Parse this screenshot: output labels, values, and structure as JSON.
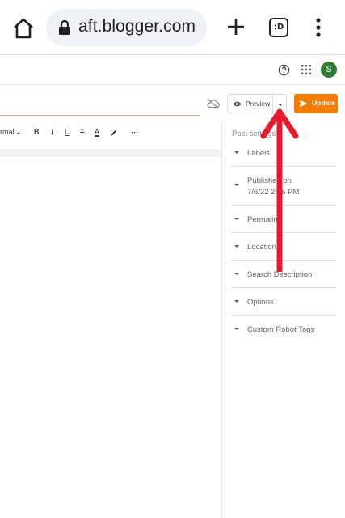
{
  "browser": {
    "url_display": "aft.blogger.com",
    "tab_switcher_label": ":D",
    "icons": [
      "home-icon",
      "lock-icon",
      "new-tab-icon",
      "tab-switcher-icon",
      "more-vert-icon"
    ]
  },
  "header": {
    "avatar_letter": "S",
    "icons": [
      "help-icon",
      "apps-icon"
    ]
  },
  "title_row": {
    "preview_label": "Preview",
    "update_label": "Update",
    "icons": [
      "cloud-off-icon",
      "eye-icon",
      "caret-down-icon",
      "send-icon"
    ]
  },
  "toolbar": {
    "format_label": "rmal",
    "bold": "B",
    "italic": "I",
    "underline": "U",
    "strikethrough": "T",
    "text_color": "A",
    "more": "⋯"
  },
  "sidebar": {
    "title": "Post settings",
    "items": [
      {
        "label": "Labels"
      },
      {
        "label": "Published on",
        "sub": "7/6/22 2:25 PM"
      },
      {
        "label": "Permalink"
      },
      {
        "label": "Location"
      },
      {
        "label": "Search Description"
      },
      {
        "label": "Options"
      },
      {
        "label": "Custom Robot Tags"
      }
    ]
  },
  "colors": {
    "accent_orange": "#f57c00",
    "avatar_green": "#2e7d32",
    "annotation_red": "#e8192c"
  }
}
